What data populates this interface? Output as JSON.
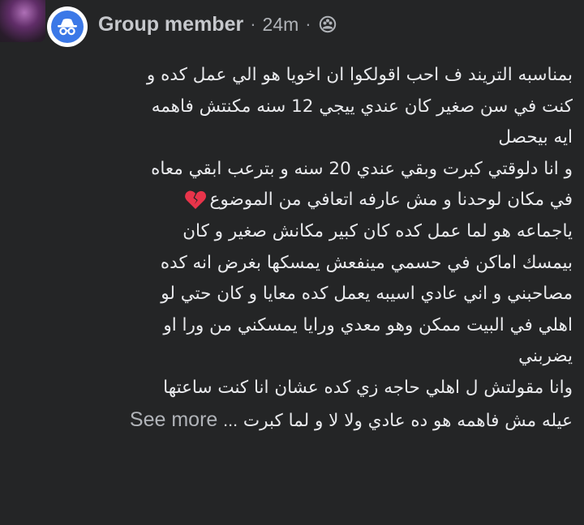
{
  "header": {
    "author_name": "Group member",
    "separator": "·",
    "time": "24m",
    "separator2": "·",
    "privacy_icon": "group-privacy-icon",
    "avatar_icon": "anonymous-member-icon"
  },
  "post": {
    "lines": [
      "بمناسبه التريند ف احب اقولكوا ان اخويا هو الي عمل كده و",
      "كنت في سن صغير كان عندي ييجي 12 سنه مكنتش فاهمه",
      "ايه بيحصل",
      "و انا دلوقتي كبرت وبقي عندي 20 سنه و بترعب ابقي معاه",
      "في مكان لوحدنا و مش عارفه اتعافي من الموضوع",
      "ياجماعه هو لما عمل كده كان كبير مكانش صغير و كان",
      "بيمسك اماكن في حسمي مينفعش يمسكها بغرض انه كده",
      "مصاحبني و اني عادي اسيبه يعمل كده معايا و كان حتي لو",
      "اهلي في البيت ممكن وهو معدي ورايا يمسكني من ورا او",
      "يضربني",
      "وانا مقولتش ل اهلي حاجه زي كده عشان انا كنت ساعتها"
    ],
    "last_line_text": "عيله مش فاهمه هو ده عادي ولا لا و لما كبرت",
    "ellipsis": "...",
    "see_more_label": "See more",
    "broken_heart_emoji": "broken-heart-icon"
  },
  "colors": {
    "background": "#242526",
    "text": "#e9eaed",
    "secondary_text": "#b0b3b8",
    "anon_avatar_blue": "#3b78e7",
    "broken_heart_red": "#e8344a"
  }
}
